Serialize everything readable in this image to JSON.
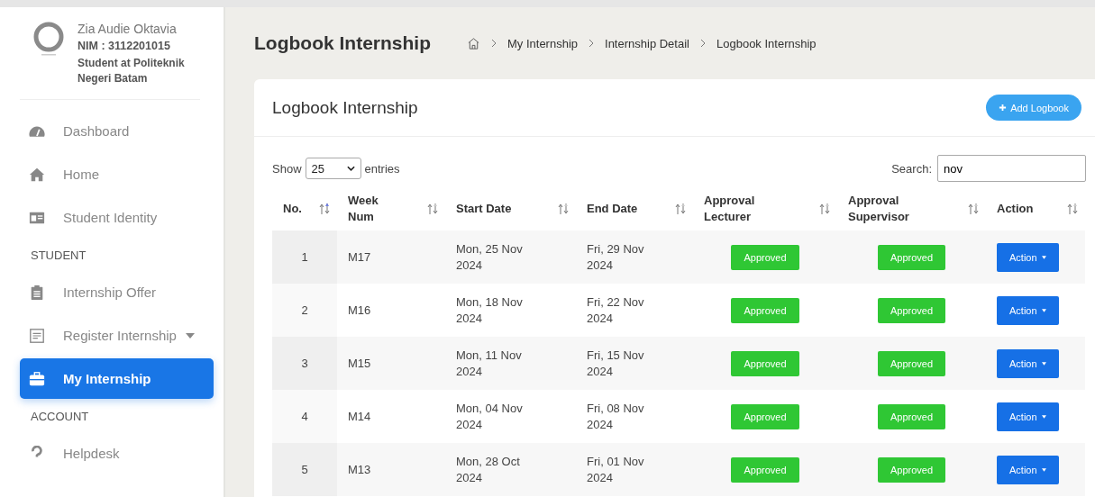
{
  "profile": {
    "name": "Zia Audie Oktavia",
    "nim": "NIM : 3112201015",
    "affiliation": "Student at Politeknik Negeri Batam"
  },
  "sidebar": {
    "items": [
      {
        "kind": "link",
        "label": "Dashboard",
        "selected": false
      },
      {
        "kind": "link",
        "label": "Home",
        "selected": false
      },
      {
        "kind": "link",
        "label": "Student Identity",
        "selected": false
      },
      {
        "kind": "heading",
        "label": "STUDENT"
      },
      {
        "kind": "link",
        "label": "Internship Offer",
        "selected": false
      },
      {
        "kind": "dropdown",
        "label": "Register Internship",
        "selected": false
      },
      {
        "kind": "link",
        "label": "My Internship",
        "selected": true
      },
      {
        "kind": "heading",
        "label": "ACCOUNT"
      },
      {
        "kind": "link",
        "label": "Helpdesk",
        "selected": false
      }
    ]
  },
  "page_title": "Logbook Internship",
  "breadcrumb": [
    "My Internship",
    "Internship Detail",
    "Logbook Internship"
  ],
  "card": {
    "title": "Logbook Internship",
    "add_button": "Add Logbook",
    "length": {
      "before": "Show",
      "value": "25",
      "after": "entries"
    },
    "search": {
      "label": "Search:",
      "value": "nov"
    },
    "table": {
      "columns": [
        {
          "label": "No.",
          "sorted": true
        },
        {
          "label": "Week Num",
          "sorted": false
        },
        {
          "label": "Start Date",
          "sorted": false
        },
        {
          "label": "End Date",
          "sorted": false
        },
        {
          "label": "Approval Lecturer",
          "sorted": false
        },
        {
          "label": "Approval Supervisor",
          "sorted": false
        },
        {
          "label": "Action",
          "sorted": false
        }
      ],
      "rows": [
        {
          "no": "1",
          "week": "M17",
          "start": "Mon, 25 Nov 2024",
          "end": "Fri, 29 Nov 2024",
          "lecturer": "Approved",
          "supervisor": "Approved",
          "action": "Action"
        },
        {
          "no": "2",
          "week": "M16",
          "start": "Mon, 18 Nov 2024",
          "end": "Fri, 22 Nov 2024",
          "lecturer": "Approved",
          "supervisor": "Approved",
          "action": "Action"
        },
        {
          "no": "3",
          "week": "M15",
          "start": "Mon, 11 Nov 2024",
          "end": "Fri, 15 Nov 2024",
          "lecturer": "Approved",
          "supervisor": "Approved",
          "action": "Action"
        },
        {
          "no": "4",
          "week": "M14",
          "start": "Mon, 04 Nov 2024",
          "end": "Fri, 08 Nov 2024",
          "lecturer": "Approved",
          "supervisor": "Approved",
          "action": "Action"
        },
        {
          "no": "5",
          "week": "M13",
          "start": "Mon, 28 Oct 2024",
          "end": "Fri, 01 Nov 2024",
          "lecturer": "Approved",
          "supervisor": "Approved",
          "action": "Action"
        }
      ]
    }
  }
}
